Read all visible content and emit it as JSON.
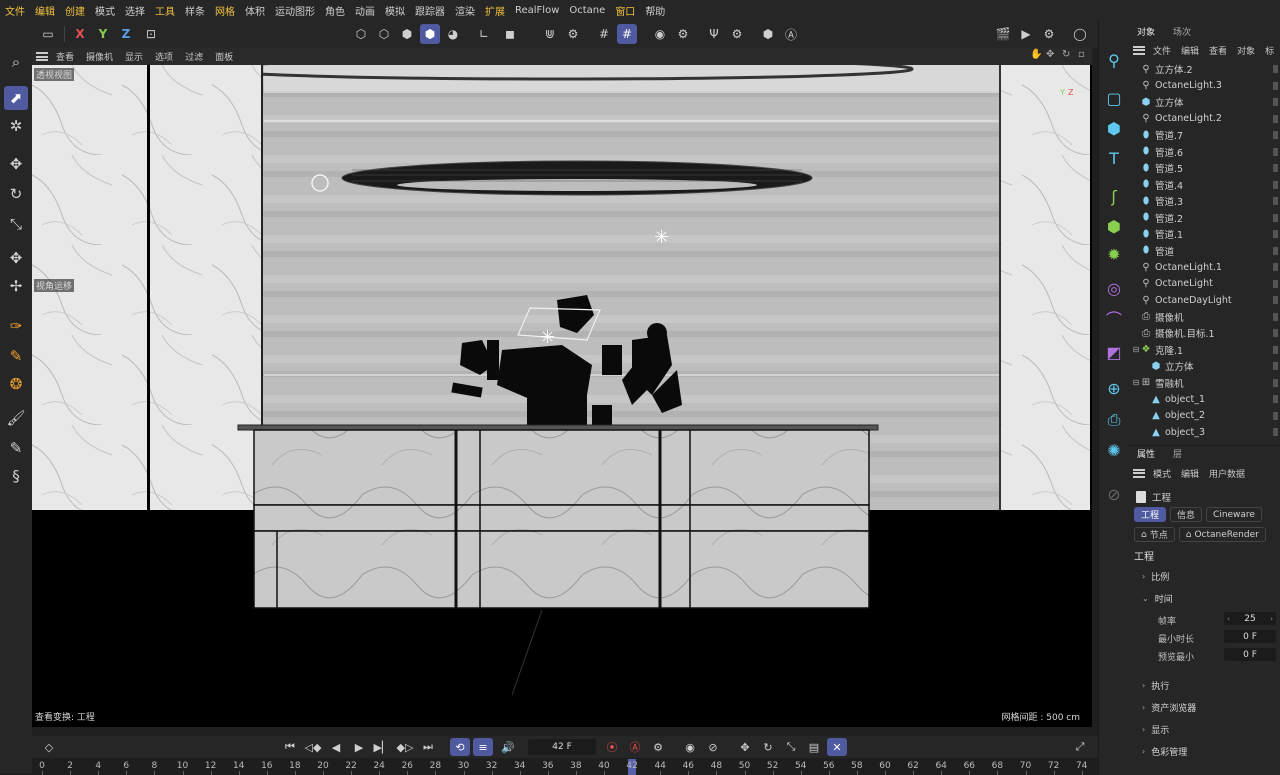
{
  "menubar": {
    "items": [
      {
        "label": "文件",
        "highlight": true
      },
      {
        "label": "编辑",
        "highlight": true
      },
      {
        "label": "创建",
        "highlight": true
      },
      {
        "label": "模式",
        "highlight": false
      },
      {
        "label": "选择",
        "highlight": false
      },
      {
        "label": "工具",
        "highlight": true
      },
      {
        "label": "样条",
        "highlight": false
      },
      {
        "label": "网格",
        "highlight": true
      },
      {
        "label": "体积",
        "highlight": false
      },
      {
        "label": "运动图形",
        "highlight": false
      },
      {
        "label": "角色",
        "highlight": false
      },
      {
        "label": "动画",
        "highlight": false
      },
      {
        "label": "模拟",
        "highlight": false
      },
      {
        "label": "跟踪器",
        "highlight": false
      },
      {
        "label": "渲染",
        "highlight": false
      },
      {
        "label": "扩展",
        "highlight": true
      },
      {
        "label": "RealFlow",
        "highlight": false
      },
      {
        "label": "Octane",
        "highlight": false
      },
      {
        "label": "窗口",
        "highlight": true
      },
      {
        "label": "帮助",
        "highlight": false
      }
    ]
  },
  "toolbar": {
    "axis_x": "X",
    "axis_y": "Y",
    "axis_z": "Z",
    "accent_color": "#4f5aa0",
    "axis_colors": {
      "x": "#e05050",
      "y": "#8ac850",
      "z": "#5aa0e8"
    }
  },
  "viewport": {
    "menu": [
      "查看",
      "摄像机",
      "显示",
      "选项",
      "过滤",
      "面板"
    ],
    "view_name": "透视视图",
    "left_label": "视角运移",
    "status_left": "查看变换: 工程",
    "status_right": "网格间距 : 500 cm"
  },
  "timeline": {
    "current_frame": "42 F",
    "ticks": [
      "0",
      "2",
      "4",
      "6",
      "8",
      "10",
      "12",
      "14",
      "16",
      "18",
      "20",
      "22",
      "24",
      "26",
      "28",
      "30",
      "32",
      "34",
      "36",
      "38",
      "40",
      "42",
      "44",
      "46",
      "48",
      "50",
      "52",
      "54",
      "56",
      "58",
      "60",
      "62",
      "64",
      "66",
      "68",
      "70",
      "72",
      "74"
    ]
  },
  "objects_panel": {
    "tabs": [
      "对象",
      "场次"
    ],
    "menu": [
      "文件",
      "编辑",
      "查看",
      "对象",
      "标"
    ],
    "items": [
      {
        "name": "立方体.2",
        "icon": "light-icon",
        "indent": 0
      },
      {
        "name": "OctaneLight.3",
        "icon": "light-icon",
        "indent": 0
      },
      {
        "name": "立方体",
        "icon": "cube-icon",
        "indent": 0
      },
      {
        "name": "OctaneLight.2",
        "icon": "light-icon",
        "indent": 0
      },
      {
        "name": "管道.7",
        "icon": "tube-icon",
        "indent": 0
      },
      {
        "name": "管道.6",
        "icon": "tube-icon",
        "indent": 0
      },
      {
        "name": "管道.5",
        "icon": "tube-icon",
        "indent": 0
      },
      {
        "name": "管道.4",
        "icon": "tube-icon",
        "indent": 0
      },
      {
        "name": "管道.3",
        "icon": "tube-icon",
        "indent": 0
      },
      {
        "name": "管道.2",
        "icon": "tube-icon",
        "indent": 0
      },
      {
        "name": "管道.1",
        "icon": "tube-icon",
        "indent": 0
      },
      {
        "name": "管道",
        "icon": "tube-icon",
        "indent": 0
      },
      {
        "name": "OctaneLight.1",
        "icon": "light-icon",
        "indent": 0
      },
      {
        "name": "OctaneLight",
        "icon": "light-icon",
        "indent": 0
      },
      {
        "name": "OctaneDayLight",
        "icon": "light-icon",
        "indent": 0
      },
      {
        "name": "摄像机",
        "icon": "camera-icon",
        "indent": 0
      },
      {
        "name": "摄像机.目标.1",
        "icon": "target-icon",
        "indent": 0
      },
      {
        "name": "克隆.1",
        "icon": "cloner-icon",
        "indent": 0,
        "expander": "minus"
      },
      {
        "name": "立方体",
        "icon": "cube-icon",
        "indent": 1
      },
      {
        "name": "雪融机",
        "icon": "null-icon",
        "indent": 0,
        "expander": "minus"
      },
      {
        "name": "object_1",
        "icon": "poly-icon",
        "indent": 1
      },
      {
        "name": "object_2",
        "icon": "poly-icon",
        "indent": 1
      },
      {
        "name": "object_3",
        "icon": "poly-icon",
        "indent": 1
      }
    ]
  },
  "attributes_panel": {
    "tabs": [
      "属性",
      "层"
    ],
    "menu": [
      "模式",
      "编辑",
      "用户数据"
    ],
    "header": "工程",
    "subtabs_row1": [
      "工程",
      "信息",
      "Cineware"
    ],
    "subtabs_row2": [
      "节点",
      "OctaneRender"
    ],
    "section_title": "工程",
    "groups": {
      "scale": "比例",
      "time": "时间",
      "execute": "执行",
      "asset_browser": "资产浏览器",
      "display": "显示",
      "color_management": "色彩管理"
    },
    "fields": [
      {
        "label": "帧率",
        "value": "25"
      },
      {
        "label": "最小时长",
        "value": "0 F"
      },
      {
        "label": "预览最小",
        "value": "0 F"
      }
    ]
  }
}
